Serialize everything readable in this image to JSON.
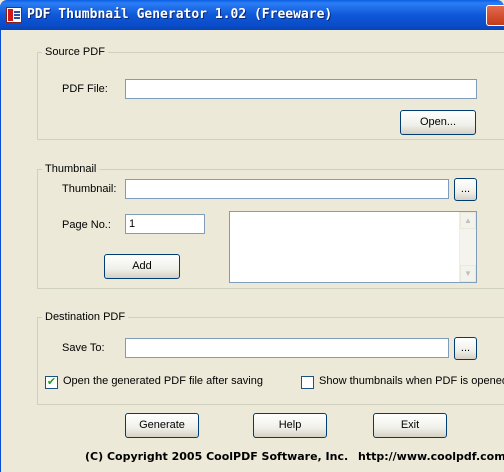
{
  "window": {
    "title": "PDF Thumbnail Generator 1.02 (Freeware)",
    "app_icon": "pdf-app-icon",
    "close_icon": "close-icon"
  },
  "source": {
    "group_label": "Source PDF",
    "file_label": "PDF File:",
    "file_value": "",
    "open_label": "Open..."
  },
  "thumbnail": {
    "group_label": "Thumbnail",
    "thumb_label": "Thumbnail:",
    "thumb_value": "",
    "browse_label": "...",
    "page_label": "Page No.:",
    "page_value": "1",
    "add_label": "Add",
    "list_items": []
  },
  "destination": {
    "group_label": "Destination PDF",
    "save_label": "Save To:",
    "save_value": "",
    "browse_label": "...",
    "open_after_label": "Open the generated PDF file after saving",
    "open_after_checked": true,
    "show_thumbs_label": "Show thumbnails when PDF is opened",
    "show_thumbs_checked": false
  },
  "actions": {
    "generate_label": "Generate",
    "help_label": "Help",
    "exit_label": "Exit"
  },
  "footer": {
    "copyright": "(C) Copyright 2005 CoolPDF Software, Inc.",
    "url": "http://www.coolpdf.com"
  }
}
